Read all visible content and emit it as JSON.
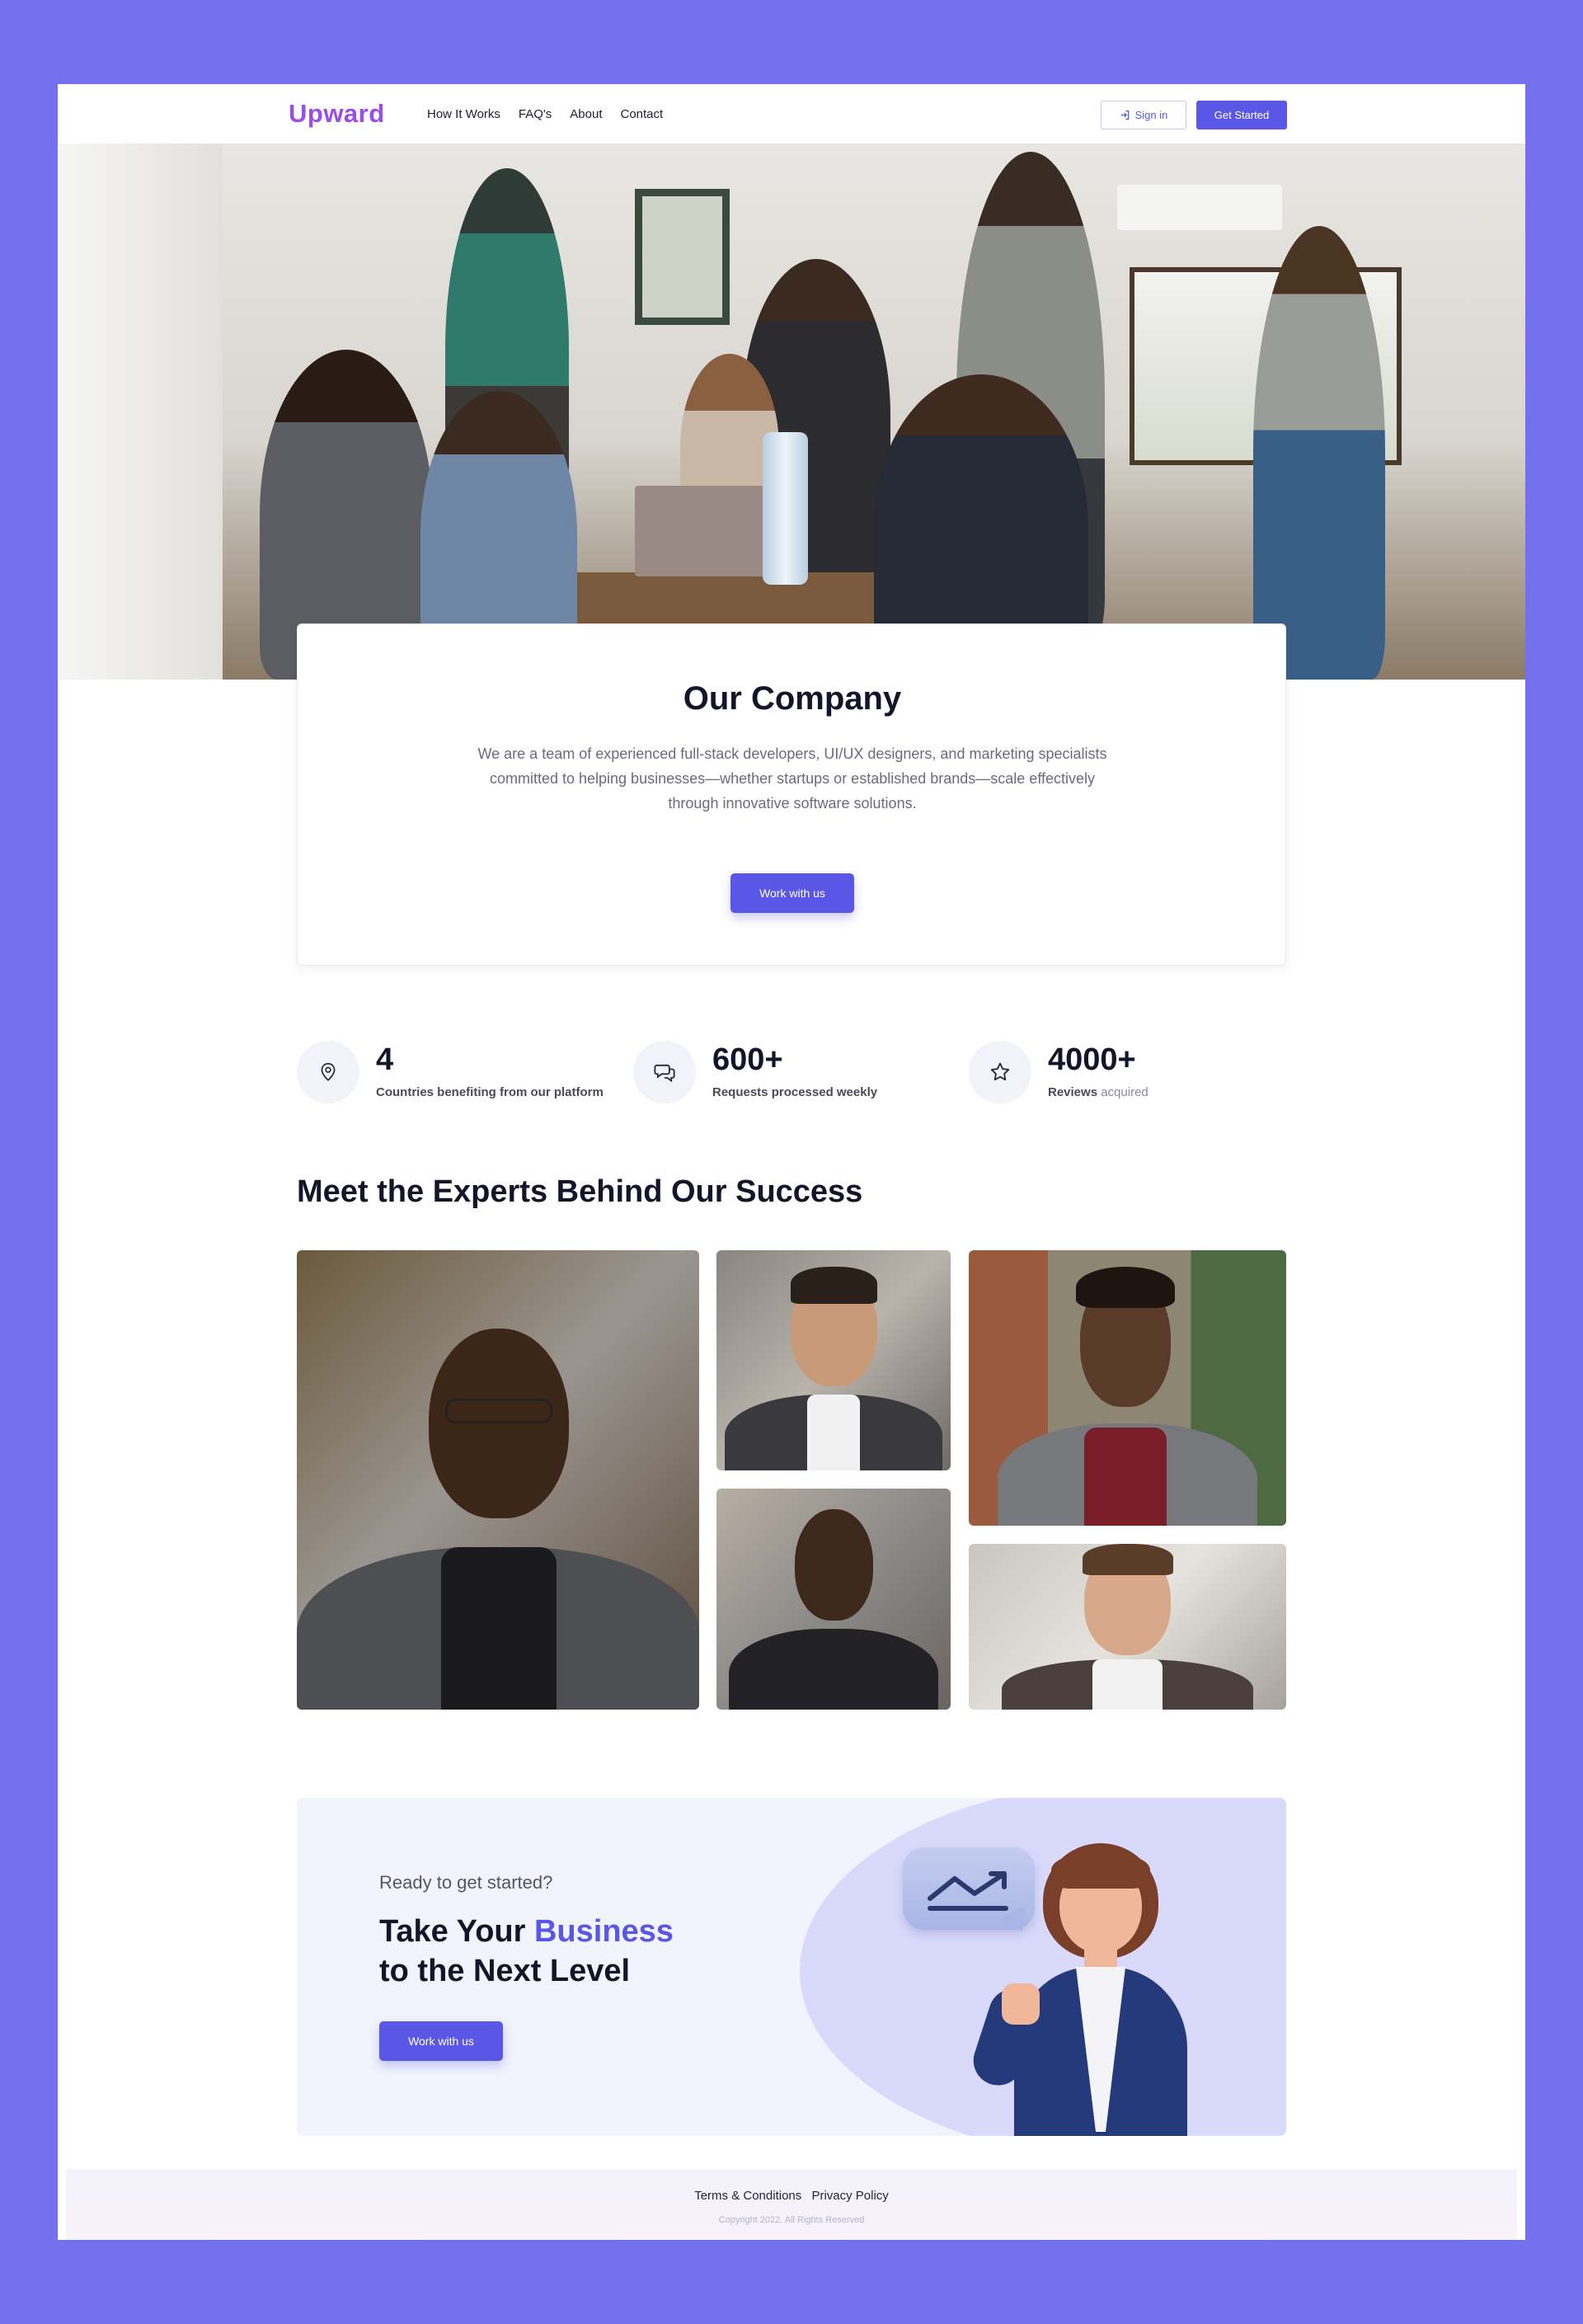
{
  "nav": {
    "logo": "Upward",
    "links": [
      "How It Works",
      "FAQ's",
      "About",
      "Contact"
    ],
    "signin_label": "Sign in",
    "get_started_label": "Get Started"
  },
  "company": {
    "title": "Our Company",
    "description": "We are a team of experienced full-stack developers, UI/UX designers, and marketing specialists committed to helping businesses—whether startups or established brands—scale effectively through innovative software solutions.",
    "button_label": "Work with us"
  },
  "stats": [
    {
      "icon": "location-pin-icon",
      "value": "4",
      "label": "Countries benefiting from our platform",
      "label_muted": ""
    },
    {
      "icon": "chat-bubbles-icon",
      "value": "600+",
      "label": "Requests processed weekly",
      "label_muted": ""
    },
    {
      "icon": "star-icon",
      "value": "4000+",
      "label": "Reviews",
      "label_muted": "acquired"
    }
  ],
  "experts": {
    "title": "Meet the Experts Behind Our Success"
  },
  "cta": {
    "pre": "Ready to get started?",
    "title_part1": "Take Your ",
    "title_accent": "Business",
    "title_part2": "to the Next Level",
    "button_label": "Work with us"
  },
  "footer": {
    "terms": "Terms & Conditions",
    "privacy": "Privacy Policy",
    "copyright": "Copyright 2022. All Rights Reserved"
  },
  "colors": {
    "accent": "#5b57e6",
    "page_background": "#7470ee",
    "logo": "#9b4dea"
  }
}
